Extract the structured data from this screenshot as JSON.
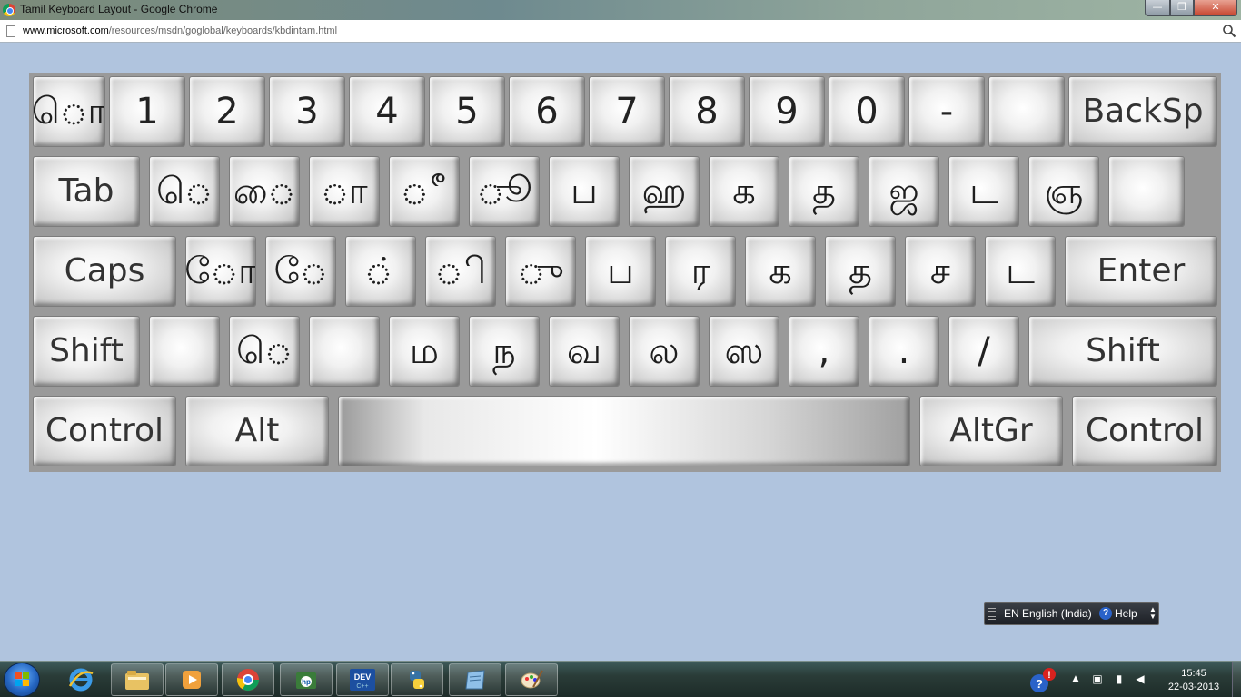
{
  "window": {
    "title": "Tamil Keyboard Layout - Google Chrome",
    "minimize": "—",
    "maximize": "❐",
    "close": "✕"
  },
  "address": {
    "url_host": "www.microsoft.com",
    "url_path": "/resources/msdn/goglobal/keyboards/kbdintam.html"
  },
  "keyboard": {
    "rows": [
      [
        "ொ",
        "1",
        "2",
        "3",
        "4",
        "5",
        "6",
        "7",
        "8",
        "9",
        "0",
        "-",
        "",
        "BackSp"
      ],
      [
        "Tab",
        "ெ",
        "ை",
        "ா",
        "ீ",
        "ூ",
        "ப",
        "ஹ",
        "க",
        "த",
        "ஜ",
        "ட",
        "ஞ",
        ""
      ],
      [
        "Caps",
        "ோ",
        "ே",
        "்",
        "ி",
        "ு",
        "ப",
        "ர",
        "க",
        "த",
        "ச",
        "ட",
        "Enter"
      ],
      [
        "Shift",
        "",
        "ெ",
        "",
        "ம",
        "ந",
        "வ",
        "ல",
        "ஸ",
        ",",
        ".",
        "/",
        "Shift"
      ],
      [
        "Control",
        "Alt",
        "",
        "AltGr",
        "Control"
      ]
    ]
  },
  "langbar": {
    "language": "EN English (India)",
    "help": "Help"
  },
  "taskbar": {
    "apps": [
      "internet-explorer",
      "file-explorer",
      "media-player",
      "chrome",
      "hp-app",
      "dev-app",
      "python",
      "notes",
      "paint"
    ],
    "time": "15:45",
    "date": "22-03-2013"
  },
  "colors": {
    "page_background": "#b0c4de",
    "keyboard_frame": "#9a9a9a"
  }
}
